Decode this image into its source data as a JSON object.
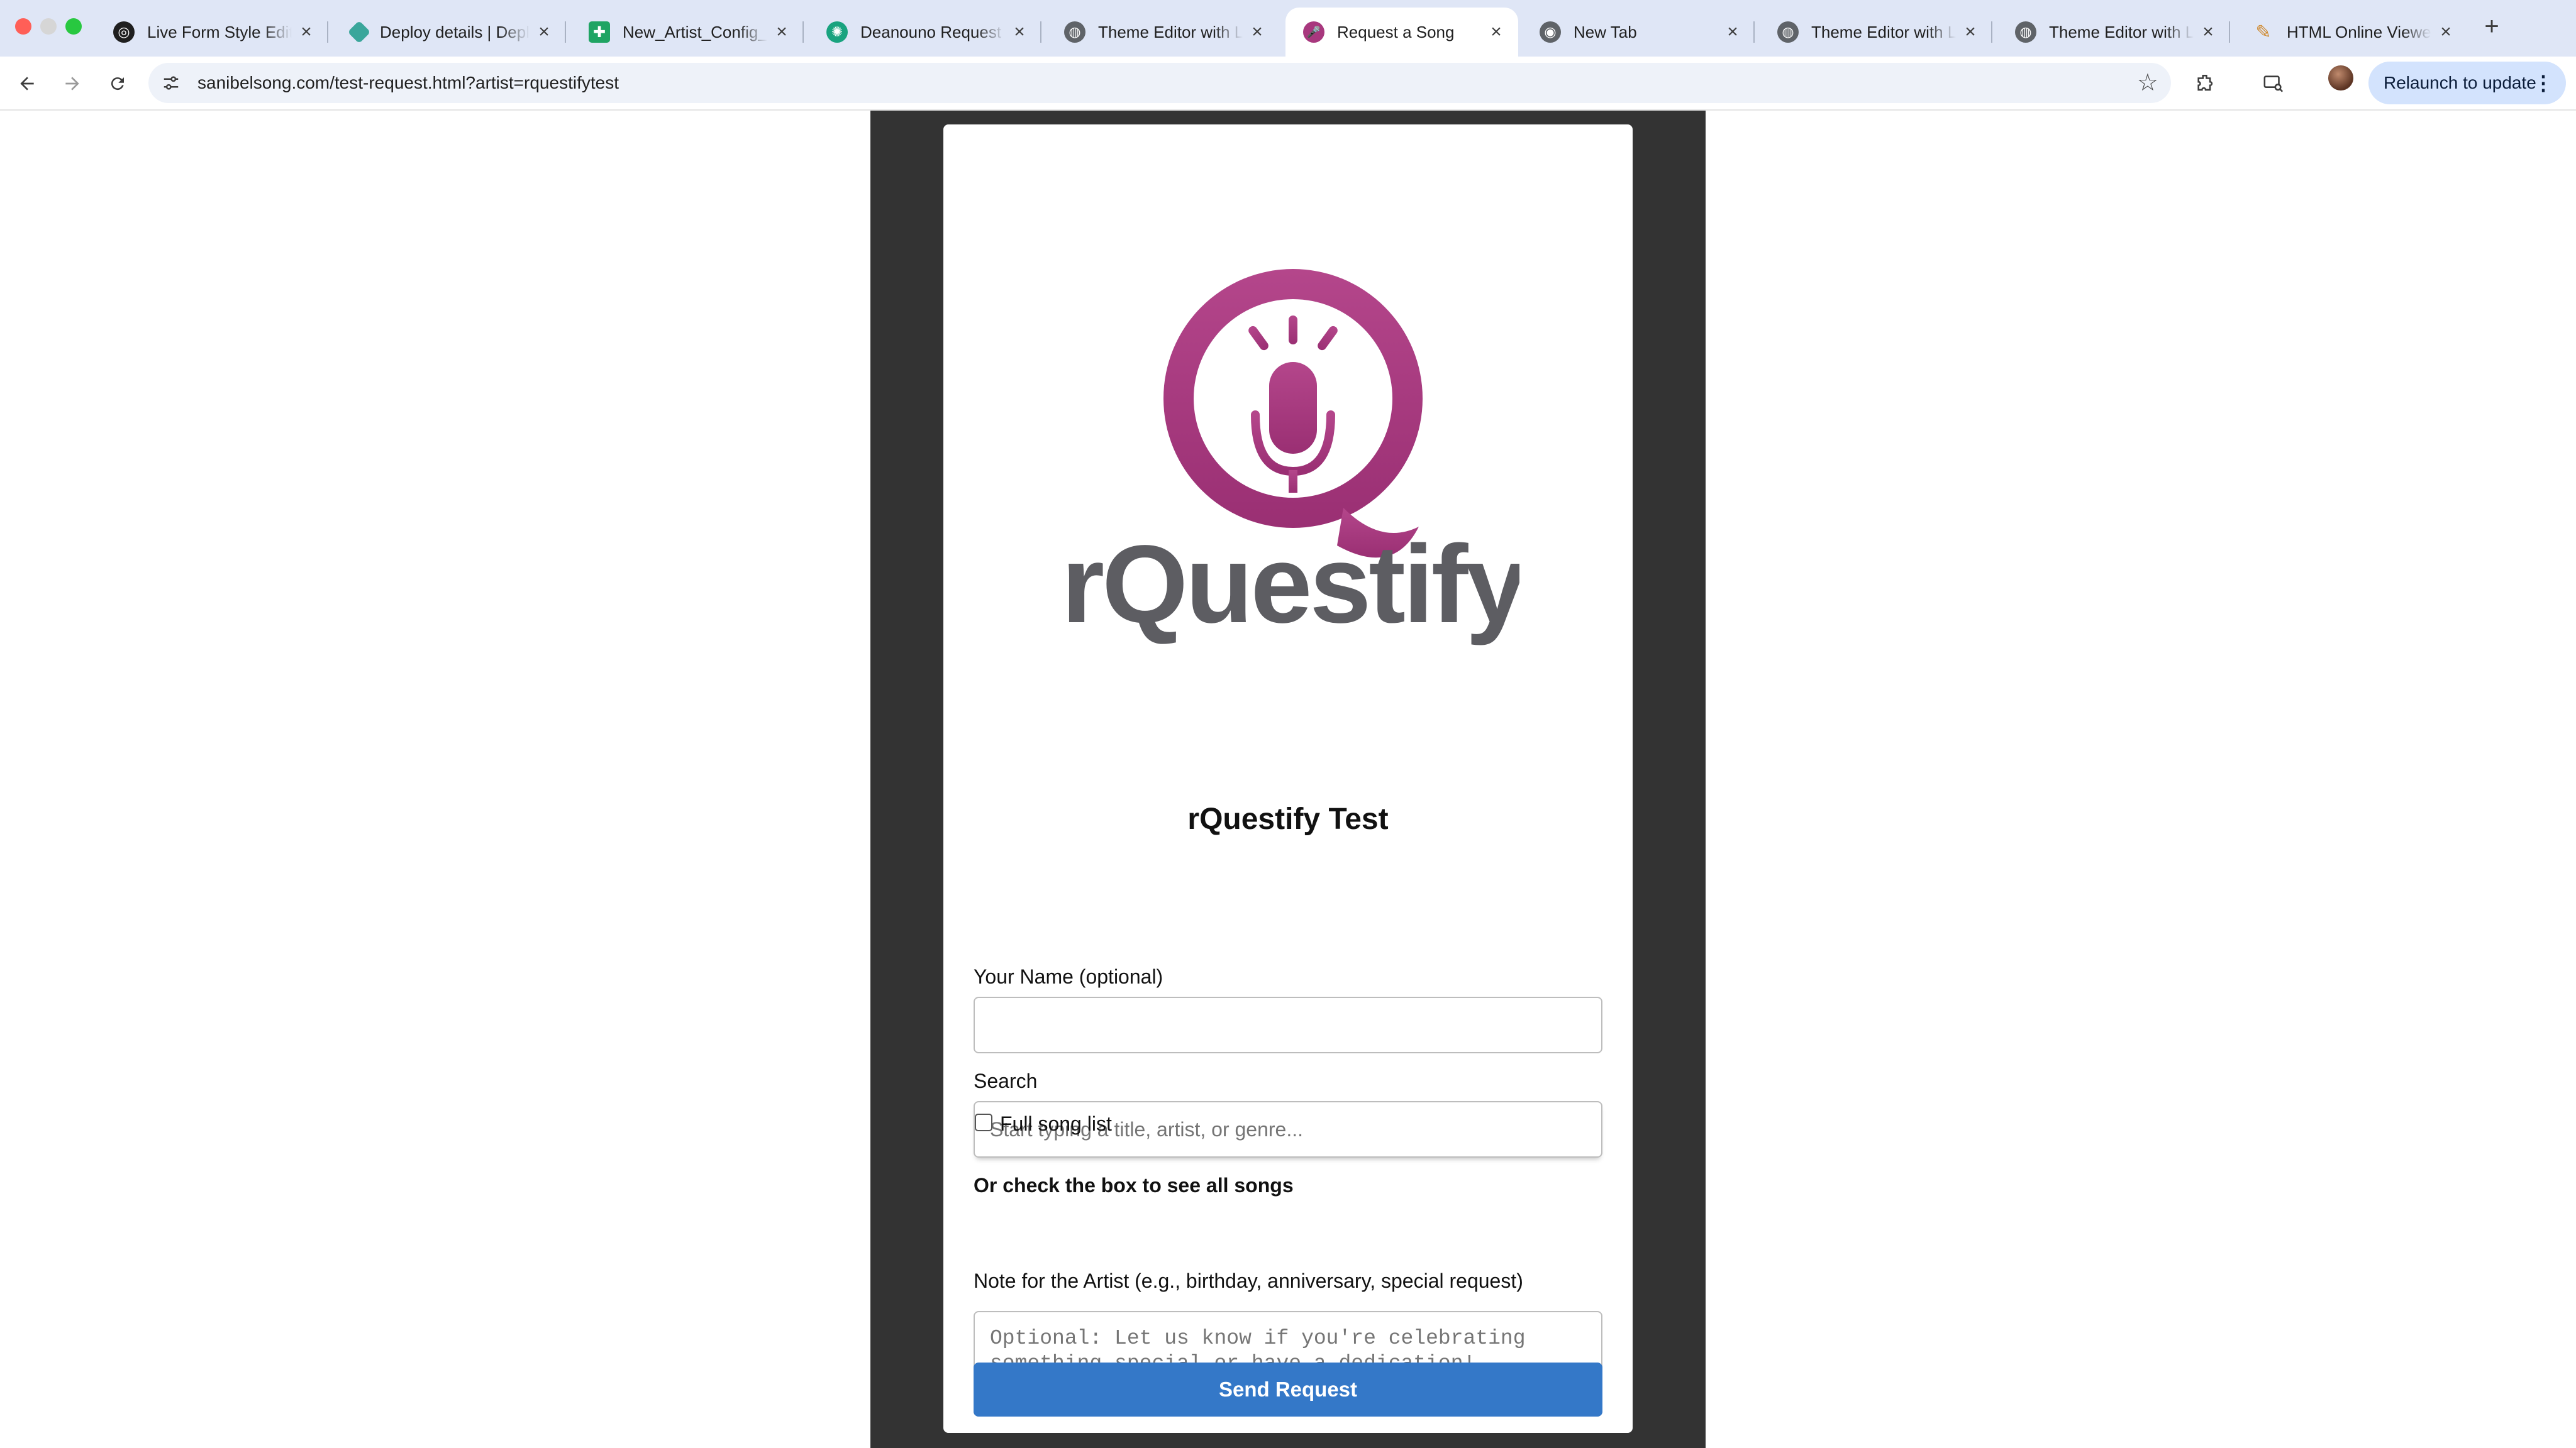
{
  "browser": {
    "tabs": [
      {
        "title": "Live Form Style Editor",
        "icon": "openai-icon",
        "active": false
      },
      {
        "title": "Deploy details | Deploy",
        "icon": "netlify-icon",
        "active": false
      },
      {
        "title": "New_Artist_Config_",
        "icon": "sheets-icon",
        "active": false
      },
      {
        "title": "Deanouno Request S",
        "icon": "chatgpt-icon",
        "active": false
      },
      {
        "title": "Theme Editor with Li",
        "icon": "globe-icon",
        "active": false
      },
      {
        "title": "Request a Song",
        "icon": "rquestify-icon",
        "active": true
      },
      {
        "title": "New Tab",
        "icon": "chrome-icon",
        "active": false
      },
      {
        "title": "Theme Editor with Li",
        "icon": "globe-icon",
        "active": false
      },
      {
        "title": "Theme Editor with Li",
        "icon": "globe-icon",
        "active": false
      },
      {
        "title": "HTML Online Viewer",
        "icon": "pencil-icon",
        "active": false
      }
    ],
    "url": "sanibelsong.com/test-request.html?artist=rquestifytest",
    "relaunch_label": "Relaunch to update",
    "colors": {
      "tabstrip": "#dfe6f6",
      "relaunch_bg": "#d3e3fd"
    }
  },
  "page": {
    "logo_text": "rQuestify",
    "logo_colors": {
      "mark": "#a8387e",
      "wordmark": "#5d5d62"
    },
    "title": "rQuestify Test",
    "name_label": "Your Name (optional)",
    "name_value": "",
    "search_label": "Search",
    "search_placeholder": "Start typing a title, artist, or genre...",
    "check_heading": "Or check the box to see all songs",
    "full_list_label": "Full song list",
    "full_list_checked": false,
    "note_label": "Note for the Artist (e.g., birthday, anniversary, special request)",
    "note_placeholder": "Optional: Let us know if you're celebrating\nsomething special or have a dedication!",
    "submit_label": "Send Request",
    "colors": {
      "frame": "#333333",
      "button": "#3478c8"
    }
  }
}
